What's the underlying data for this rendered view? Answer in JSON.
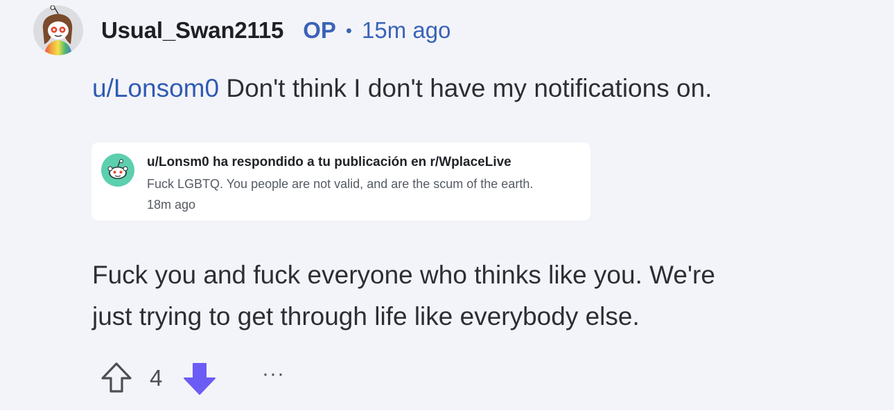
{
  "comment": {
    "author": "Usual_Swan2115",
    "op_badge": "OP",
    "separator": "•",
    "time": "15m ago",
    "avatar_icon": "snoo-avatar-icon",
    "mention": "u/Lonsom0",
    "first_line_rest": " Don't think I don't have my notifications on.",
    "body_line_1": "Fuck you and fuck everyone who thinks like you. We're",
    "body_line_2": "just trying to get through life like everybody else."
  },
  "screenshot": {
    "title": "u/Lonsm0 ha respondido a tu publicación en r/WplaceLive",
    "body": "Fuck LGBTQ. You people are not valid, and are the scum of the earth.",
    "time": "18m ago",
    "avatar_icon": "reddit-snoo-icon"
  },
  "actions": {
    "score": "4",
    "upvote_icon": "upvote-arrow-icon",
    "downvote_icon": "downvote-arrow-icon",
    "more_label": "···",
    "downvote_color": "#6b5cf5"
  },
  "colors": {
    "background": "#f3f4f9",
    "link": "#3a63b8",
    "text": "#2b2f33"
  }
}
